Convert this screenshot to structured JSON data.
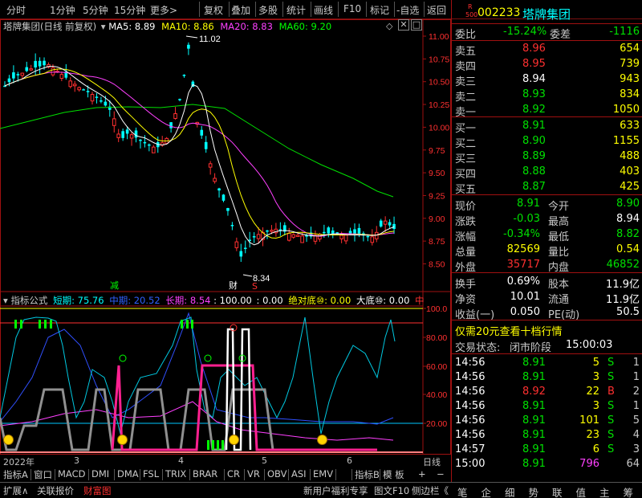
{
  "toolbar": {
    "left": [
      "分时",
      "1分钟",
      "5分钟",
      "15分钟",
      "更多>"
    ],
    "right": [
      "复权",
      "叠加",
      "多股",
      "统计",
      "画线",
      "F10",
      "标记",
      "-自选",
      "返回"
    ]
  },
  "chart_header": {
    "title": "塔牌集团(日线 前复权)",
    "ma5": "MA5: 8.89",
    "ma10": "MA10: 8.86",
    "ma20": "MA20: 8.83",
    "ma60": "MA60: 9.20",
    "colors": {
      "ma5": "#ffffff",
      "ma10": "#ffff00",
      "ma20": "#ff40ff",
      "ma60": "#00ff00",
      "up": "#ff3030",
      "down": "#00ffff"
    }
  },
  "price_axis": [
    "11.00",
    "10.75",
    "10.50",
    "10.25",
    "10.00",
    "9.75",
    "9.50",
    "9.25",
    "9.00",
    "8.75",
    "8.50"
  ],
  "price_marks": {
    "high": "11.02",
    "low": "8.34"
  },
  "chart_markers": {
    "jian": "减",
    "cai": "财",
    "s": "S"
  },
  "indicator_header": {
    "title": "指标公式",
    "short": "短期: 75.76",
    "mid": "中期: 20.52",
    "long": "长期: 8.54",
    "v100": ": 100.00",
    "v0": ": 0.00",
    "abs_bottom": "绝对底⑩: 0.00",
    "big_bottom": "大底⑩: 0.00",
    "tail": "中"
  },
  "indicator_axis": [
    "100.0",
    "80.00",
    "60.00",
    "40.00",
    "20.00"
  ],
  "date_axis": {
    "start": "2022年",
    "m3": "3",
    "m4": "4",
    "m5": "5",
    "m6": "6",
    "label": "日线"
  },
  "bottom_tabs": [
    "指标A",
    "窗口",
    "MACD",
    "DMI",
    "DMA",
    "FSL",
    "TRIX",
    "BRAR",
    "CR",
    "VR",
    "OBV",
    "ASI",
    "EMV",
    "指标B",
    "模 板",
    "+",
    "−"
  ],
  "bottom_bar": {
    "left": [
      "扩展∧",
      "关联报价",
      "财富图"
    ],
    "right_text": [
      "新用户福利专享",
      "图文F10",
      "侧边栏《"
    ],
    "right_icons": [
      "笔",
      "企",
      "细",
      "势",
      "联",
      "值",
      "主",
      "筹"
    ]
  },
  "stock": {
    "code": "002233",
    "name": "塔牌集团",
    "badge_top": "R",
    "badge_bottom": "500"
  },
  "weibi": {
    "label": "委比",
    "value": "-15.24%",
    "label2": "委差",
    "value2": "-1116"
  },
  "sells": [
    {
      "label": "卖五",
      "price": "8.96",
      "vol": "654"
    },
    {
      "label": "卖四",
      "price": "8.95",
      "vol": "739"
    },
    {
      "label": "卖三",
      "price": "8.94",
      "vol": "943"
    },
    {
      "label": "卖二",
      "price": "8.93",
      "vol": "834"
    },
    {
      "label": "卖一",
      "price": "8.92",
      "vol": "1050"
    }
  ],
  "buys": [
    {
      "label": "买一",
      "price": "8.91",
      "vol": "633"
    },
    {
      "label": "买二",
      "price": "8.90",
      "vol": "1155"
    },
    {
      "label": "买三",
      "price": "8.89",
      "vol": "488"
    },
    {
      "label": "买四",
      "price": "8.88",
      "vol": "403"
    },
    {
      "label": "买五",
      "price": "8.87",
      "vol": "425"
    }
  ],
  "quote": [
    {
      "l1": "现价",
      "v1": "8.91",
      "l2": "今开",
      "v2": "8.90"
    },
    {
      "l1": "涨跌",
      "v1": "-0.03",
      "l2": "最高",
      "v2": "8.94"
    },
    {
      "l1": "涨幅",
      "v1": "-0.34%",
      "l2": "最低",
      "v2": "8.82"
    },
    {
      "l1": "总量",
      "v1": "82569",
      "l2": "量比",
      "v2": "0.54"
    },
    {
      "l1": "外盘",
      "v1": "35717",
      "l2": "内盘",
      "v2": "46852"
    }
  ],
  "fund": [
    {
      "l1": "换手",
      "v1": "0.69%",
      "l2": "股本",
      "v2": "11.9亿"
    },
    {
      "l1": "净资",
      "v1": "10.01",
      "l2": "流通",
      "v2": "11.9亿"
    },
    {
      "l1": "收益(一)",
      "v1": "0.050",
      "l2": "PE(动)",
      "v2": "50.5"
    }
  ],
  "promo": "仅需20元查看十档行情",
  "trade_status": {
    "label": "交易状态:",
    "value": "闭市阶段",
    "time": "15:00:03"
  },
  "ticks": [
    {
      "t": "14:56",
      "p": "8.91",
      "v": "5",
      "bs": "S",
      "n": "1"
    },
    {
      "t": "14:56",
      "p": "8.91",
      "v": "3",
      "bs": "S",
      "n": "1"
    },
    {
      "t": "14:56",
      "p": "8.92",
      "v": "22",
      "bs": "B",
      "n": "2"
    },
    {
      "t": "14:56",
      "p": "8.91",
      "v": "3",
      "bs": "S",
      "n": "1"
    },
    {
      "t": "14:56",
      "p": "8.91",
      "v": "101",
      "bs": "S",
      "n": "5"
    },
    {
      "t": "14:56",
      "p": "8.91",
      "v": "23",
      "bs": "S",
      "n": "4"
    },
    {
      "t": "14:57",
      "p": "8.91",
      "v": "6",
      "bs": "S",
      "n": "3"
    },
    {
      "t": "15:00",
      "p": "8.91",
      "v": "796",
      "bs": "",
      "n": "64"
    }
  ]
}
